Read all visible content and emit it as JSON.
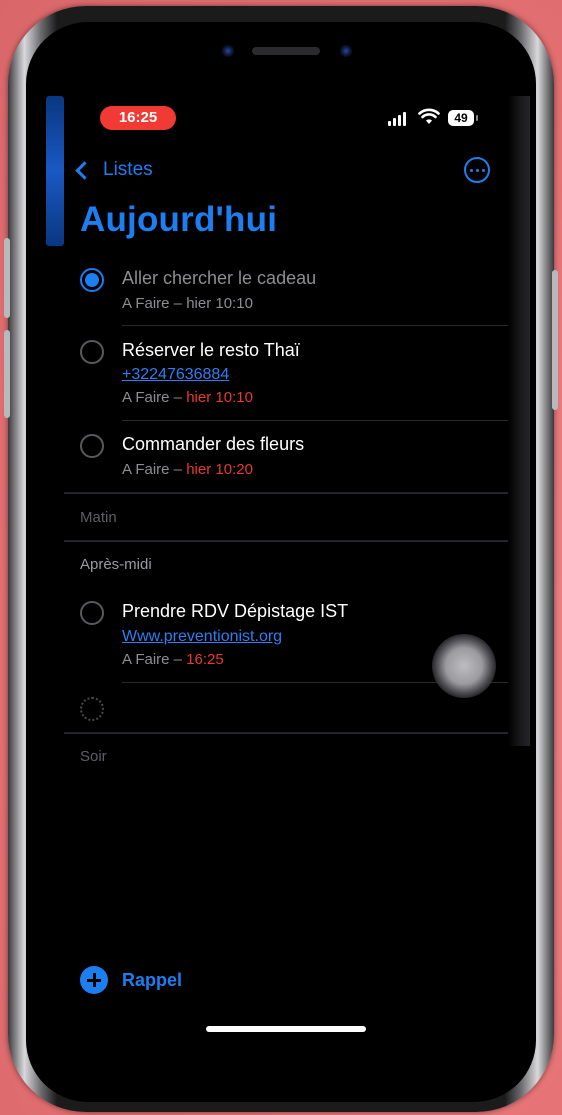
{
  "status_bar": {
    "time": "16:25",
    "battery": "49"
  },
  "nav": {
    "back_label": "Listes",
    "more_icon": "ellipsis-circle-icon"
  },
  "page_title": "Aujourd'hui",
  "tasks_top": [
    {
      "title": "Aller chercher le cadeau",
      "link": "",
      "meta_prefix": "A Faire – hier 10:10",
      "meta_late": "",
      "completed": true
    },
    {
      "title": "Réserver le resto Thaï",
      "link": "+32247636884",
      "meta_prefix": "A Faire – ",
      "meta_late": "hier 10:10",
      "completed": false
    },
    {
      "title": "Commander des fleurs",
      "link": "",
      "meta_prefix": "A Faire – ",
      "meta_late": "hier 10:20",
      "completed": false
    }
  ],
  "sections": {
    "matin": "Matin",
    "apres_midi": "Après-midi",
    "soir": "Soir"
  },
  "tasks_afternoon": [
    {
      "title": "Prendre RDV Dépistage IST",
      "link": "Www.preventionist.org",
      "meta_prefix": "A Faire – ",
      "meta_late": "16:25",
      "completed": false
    }
  ],
  "add_reminder_label": "Rappel",
  "colors": {
    "accent": "#1c7ef0",
    "late": "#e8392f",
    "time_pill": "#f23a35",
    "background": "#000000"
  }
}
